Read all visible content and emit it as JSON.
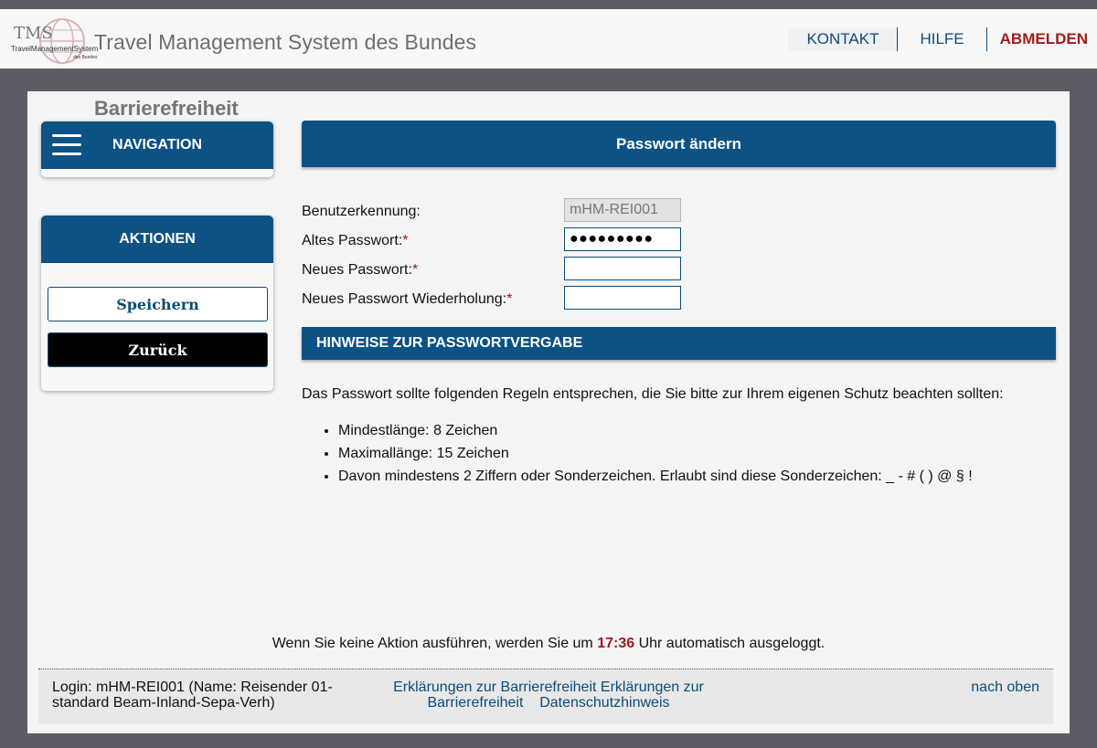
{
  "header": {
    "logo_text": "TMS TravelManagementSystem des Bundes",
    "title": "Travel Management System des Bundes",
    "nav": {
      "contact": "KONTAKT",
      "help": "HILFE",
      "logout": "ABMELDEN"
    }
  },
  "accessibility_label": "Barrierefreiheit",
  "sidebar": {
    "navigation_title": "NAVIGATION",
    "actions_title": "AKTIONEN",
    "save_label": "Speichern",
    "back_label": "Zurück"
  },
  "main": {
    "title": "Passwort ändern",
    "form": {
      "user_label": "Benutzerkennung:",
      "user_value": "mHM-REI001",
      "old_pw_label": "Altes Passwort:",
      "old_pw_value": "●●●●●●●●●",
      "new_pw_label": "Neues Passwort:",
      "new_pw_value": "",
      "repeat_pw_label": "Neues Passwort Wiederholung:",
      "repeat_pw_value": "",
      "required_marker": "*"
    },
    "hints": {
      "title": "HINWEISE ZUR PASSWORTVERGABE",
      "intro": "Das Passwort sollte folgenden Regeln entsprechen, die Sie bitte zur Ihrem eigenen Schutz beachten sollten:",
      "rules": [
        "Mindestlänge: 8 Zeichen",
        "Maximallänge: 15 Zeichen",
        "Davon mindestens 2 Ziffern oder Sonderzeichen. Erlaubt sind diese Sonderzeichen: _ - # ( ) @ § !"
      ]
    }
  },
  "timeout": {
    "before": "Wenn Sie keine Aktion ausführen, werden Sie um ",
    "time": "17:36",
    "after": " Uhr automatisch ausgeloggt."
  },
  "footer": {
    "login_info": "Login: mHM-REI001 (Name: Reisender 01-standard Beam-Inland-Sepa-Verh)",
    "link_accessibility_1": "Erklärungen zur Barrierefreiheit",
    "link_accessibility_2": "Erklärungen zur Barrierefreiheit",
    "link_privacy": "Datenschutzhinweis",
    "to_top": "nach oben"
  },
  "colors": {
    "primary": "#0c5285",
    "link": "#0c4c78",
    "accent_red": "#a31b1b",
    "background": "#5c5c66"
  }
}
